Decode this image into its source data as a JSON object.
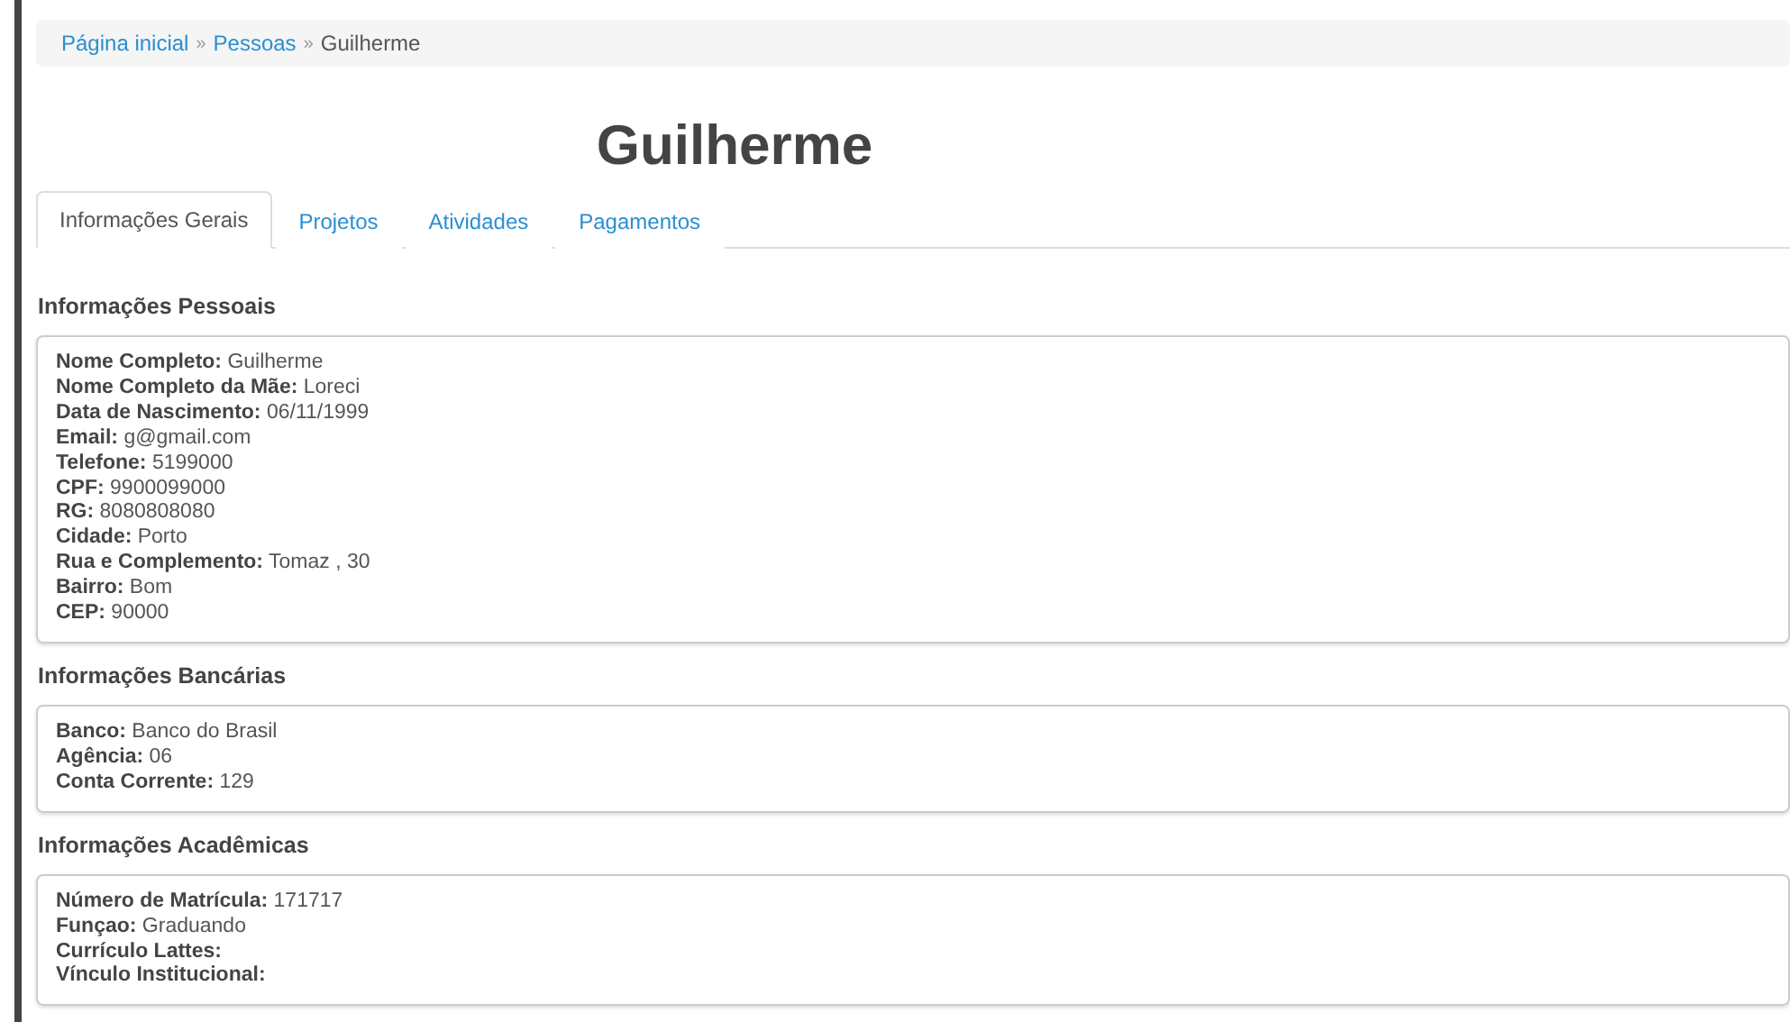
{
  "breadcrumb": [
    {
      "label": "Página inicial",
      "kind": "link"
    },
    {
      "label": "»",
      "kind": "separator"
    },
    {
      "label": "Pessoas",
      "kind": "link"
    },
    {
      "label": "»",
      "kind": "separator"
    },
    {
      "label": "Guilherme",
      "kind": "current"
    }
  ],
  "title": "Guilherme",
  "tabs": [
    {
      "label": "Informações Gerais",
      "selected": true
    },
    {
      "label": "Projetos",
      "selected": false
    },
    {
      "label": "Atividades",
      "selected": false
    },
    {
      "label": "Pagamentos",
      "selected": false
    }
  ],
  "sections": [
    {
      "heading": "Informações Pessoais",
      "rows": [
        "**Nome Completo:** Guilherme",
        "**Nome Completo da Mãe:** Loreci",
        "**Data de Nascimento:** 06/11/1999",
        "**Email:** g@gmail.com",
        "**Telefone:** 5199000",
        "**CPF:** 9900099000",
        "**RG:** 8080808080",
        "**Cidade:** Porto",
        "**Rua e Complemento:** Tomaz , 30",
        "**Bairro:** Bom",
        "**CEP:** 90000"
      ]
    },
    {
      "heading": "Informações Bancárias",
      "rows": [
        "**Banco:** Banco do Brasil",
        "**Agência:** 06",
        "**Conta Corrente:** 129"
      ]
    },
    {
      "heading": "Informações Acadêmicas",
      "rows": [
        "**Número de Matrícula:** 171717",
        "**Funçao:** Graduando",
        "**Currículo Lattes:**",
        "**Vínculo Institucional:**"
      ]
    }
  ]
}
